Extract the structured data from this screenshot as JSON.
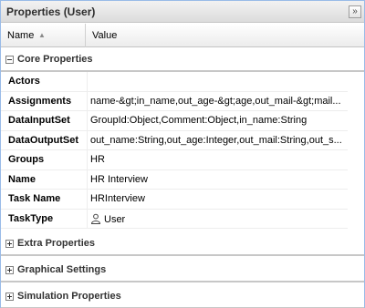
{
  "panel": {
    "title": "Properties (User)",
    "collapse_glyph": "»"
  },
  "columns": {
    "name": "Name",
    "value": "Value",
    "sort_glyph": "▲"
  },
  "groups": {
    "core": "Core Properties",
    "extra": "Extra Properties",
    "graphical": "Graphical Settings",
    "simulation": "Simulation Properties"
  },
  "properties": [
    {
      "name": "Actors",
      "value": ""
    },
    {
      "name": "Assignments",
      "value": "name-&gt;in_name,out_age-&gt;age,out_mail-&gt;mail..."
    },
    {
      "name": "DataInputSet",
      "value": "GroupId:Object,Comment:Object,in_name:String"
    },
    {
      "name": "DataOutputSet",
      "value": "out_name:String,out_age:Integer,out_mail:String,out_s..."
    },
    {
      "name": "Groups",
      "value": "HR"
    },
    {
      "name": "Name",
      "value": "HR Interview"
    },
    {
      "name": "Task Name",
      "value": "HRInterview"
    },
    {
      "name": "TaskType",
      "value": "User",
      "icon": "user-icon"
    }
  ]
}
